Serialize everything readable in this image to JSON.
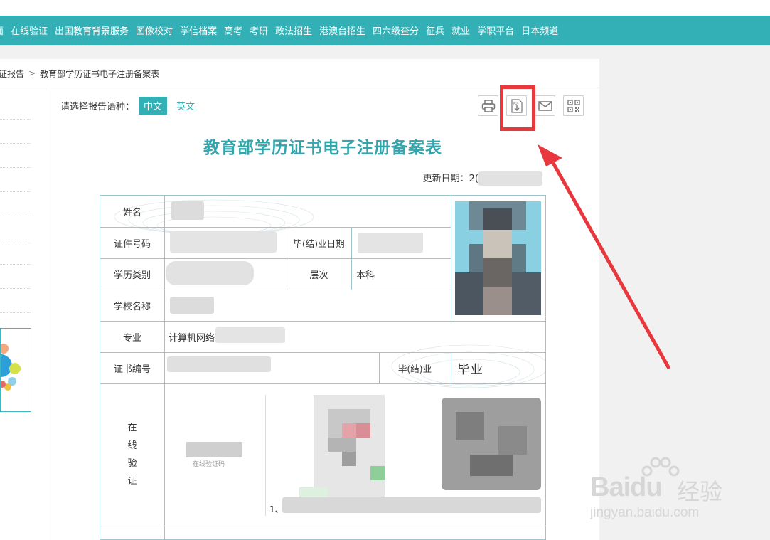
{
  "nav": {
    "items": [
      "面",
      "在线验证",
      "出国教育背景服务",
      "图像校对",
      "学信档案",
      "高考",
      "考研",
      "政法招生",
      "港澳台招生",
      "四六级查分",
      "征兵",
      "就业",
      "学职平台",
      "日本频道"
    ]
  },
  "breadcrumb": {
    "parent": "证报告",
    "separator": ">",
    "current": "教育部学历证书电子注册备案表"
  },
  "lang": {
    "prompt": "请选择报告语种：",
    "zh": "中文",
    "en": "英文"
  },
  "toolbar": {
    "print_icon": "printer-icon",
    "pdf_icon": "pdf-download-icon",
    "mail_icon": "mail-icon",
    "qr_icon": "qrcode-icon",
    "pdf_text": "PDF"
  },
  "doc": {
    "title": "教育部学历证书电子注册备案表",
    "update_date_label": "更新日期：",
    "update_date_visible": "2("
  },
  "cert": {
    "name_label": "姓名",
    "id_label": "证件号码",
    "grad_date_label": "毕(结)业日期",
    "type_label": "学历类别",
    "level_label": "层次",
    "level_value": "本科",
    "school_label": "学校名称",
    "major_label": "专业",
    "major_value": "计算机网络",
    "cert_no_label": "证书编号",
    "grad_label": "毕(结)业",
    "grad_value": "毕业",
    "online_verify_chars": [
      "在",
      "线",
      "验",
      "证"
    ],
    "online_code_caption": "在线验证码",
    "bottom_prefix": "1、"
  },
  "colors": {
    "brand": "#32b0b5",
    "title": "#32a5ad",
    "highlight": "#e8383d",
    "border": "#9cc6cc"
  },
  "watermark": {
    "brand": "Bai",
    "brand2": "du",
    "suffix": "经验",
    "url": "jingyan.baidu.com"
  }
}
